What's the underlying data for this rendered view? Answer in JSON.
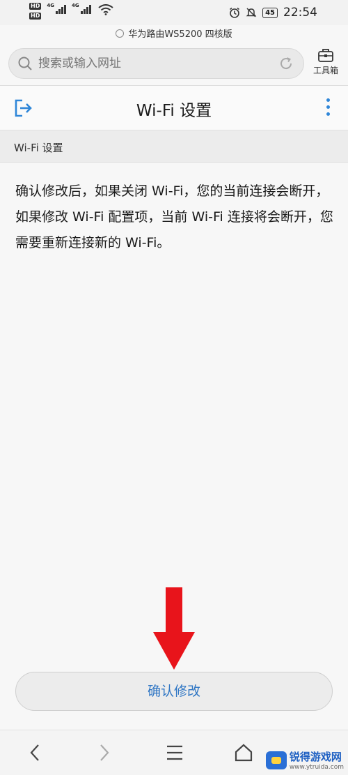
{
  "status_bar": {
    "hd1": "HD",
    "hd2": "HD",
    "net1": "4G",
    "net2": "4G",
    "battery": "45",
    "time": "22:54"
  },
  "browser": {
    "page_hint": "华为路由WS5200 四核版",
    "search_placeholder": "搜索或输入网址",
    "toolbox_label": "工具箱"
  },
  "header": {
    "title": "Wi-Fi 设置"
  },
  "section": {
    "label": "Wi-Fi 设置"
  },
  "message": "确认修改后，如果关闭 Wi-Fi，您的当前连接会断开，如果修改 Wi-Fi 配置项，当前 Wi-Fi 连接将会断开，您需要重新连接新的 Wi-Fi。",
  "confirm_button": "确认修改",
  "colors": {
    "accent": "#2f86d8",
    "arrow": "#e8141b"
  },
  "watermark": {
    "title": "锐得游戏网",
    "url": "www.ytruida.com"
  }
}
